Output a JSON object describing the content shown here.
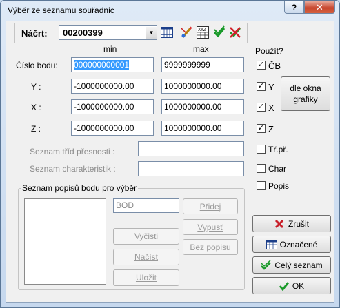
{
  "window": {
    "title": "Výběr ze seznamu souřadnic",
    "help": "?",
    "close": "✕"
  },
  "toolbar": {
    "nacrt_label": "Náčrt:",
    "nacrt_value": "00200399"
  },
  "columns": {
    "min": "min",
    "max": "max",
    "use": "Použít?"
  },
  "rows": {
    "cislo": {
      "label": "Číslo bodu:",
      "min": "000000000001",
      "max": "9999999999",
      "use_label": "ČB",
      "checked": true
    },
    "y": {
      "label": "Y :",
      "min": "-1000000000.00",
      "max": "1000000000.00",
      "use_label": "Y",
      "checked": true
    },
    "x": {
      "label": "X :",
      "min": "-1000000000.00",
      "max": "1000000000.00",
      "use_label": "X",
      "checked": true
    },
    "z": {
      "label": "Z :",
      "min": "-1000000000.00",
      "max": "1000000000.00",
      "use_label": "Z",
      "checked": true
    }
  },
  "extra": {
    "presnost_label": "Seznam tříd přesnosti :",
    "presnost_value": "",
    "char_label": "Seznam charakteristik :",
    "char_value": "",
    "trpr": "Tř.př.",
    "char": "Char",
    "popis": "Popis"
  },
  "dle_okna": {
    "line1": "dle okna",
    "line2": "grafiky"
  },
  "popisy": {
    "title": "Seznam popisů bodu pro výběr",
    "input_value": "BOD",
    "pridej": "Přidej",
    "vypust": "Vypusť",
    "bez_popisu": "Bez popisu",
    "vycisti": "Vyčisti",
    "nacist": "Načíst",
    "ulozit": "Uložit"
  },
  "actions": {
    "zrusit": "Zrušit",
    "oznacene": "Označené",
    "cely_seznam": "Celý seznam",
    "ok": "OK"
  }
}
